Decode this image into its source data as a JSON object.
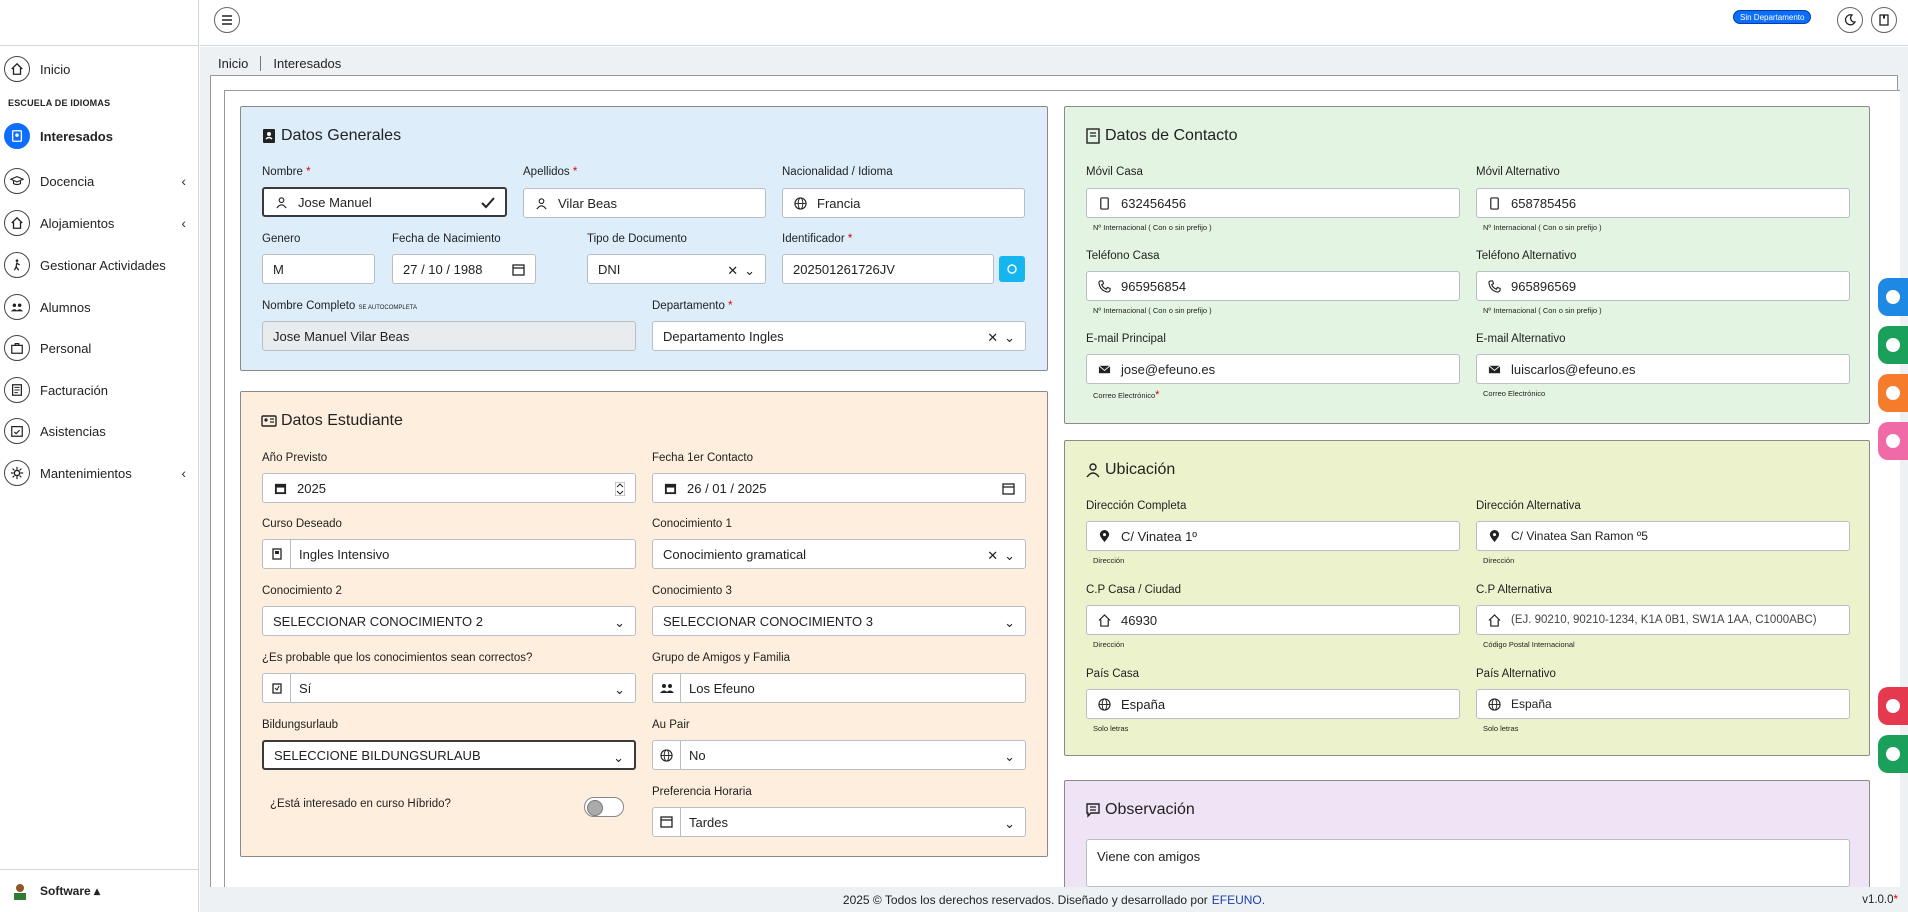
{
  "sidebar": {
    "home": "Inicio",
    "section": "ESCUELA DE IDIOMAS",
    "items": [
      {
        "label": "Interesados",
        "icon": "user-badge-icon",
        "chevron": ""
      },
      {
        "label": "Docencia",
        "icon": "graduation-cap-icon",
        "chevron": "‹"
      },
      {
        "label": "Alojamientos",
        "icon": "house-icon",
        "chevron": "‹"
      },
      {
        "label": "Gestionar Actividades",
        "icon": "hiking-icon",
        "chevron": ""
      },
      {
        "label": "Alumnos",
        "icon": "users-icon",
        "chevron": ""
      },
      {
        "label": "Personal",
        "icon": "briefcase-icon",
        "chevron": ""
      },
      {
        "label": "Facturación",
        "icon": "invoice-icon",
        "chevron": ""
      },
      {
        "label": "Asistencias",
        "icon": "calendar-check-icon",
        "chevron": ""
      },
      {
        "label": "Mantenimientos",
        "icon": "gear-icon",
        "chevron": "‹"
      }
    ],
    "bottom": "Software ▴"
  },
  "topbar": {
    "badge": "Sin Departamento"
  },
  "breadcrumb": {
    "home": "Inicio",
    "current": "Interesados"
  },
  "generales": {
    "title": "Datos Generales",
    "nombre_label": "Nombre",
    "nombre": "Jose Manuel",
    "apellidos_label": "Apellidos",
    "apellidos": "Vilar Beas",
    "nacionalidad_label": "Nacionalidad / Idioma",
    "nacionalidad": "Francia",
    "genero_label": "Genero",
    "genero": "M",
    "fecha_label": "Fecha de Nacimiento",
    "fecha": "27 / 10 / 1988",
    "tipo_doc_label": "Tipo de Documento",
    "tipo_doc": "DNI",
    "identificador_label": "Identificador",
    "identificador": "202501261726JV",
    "completo_label": "Nombre Completo",
    "completo_hint": "se autocompleta",
    "completo": "Jose Manuel Vilar Beas",
    "departamento_label": "Departamento",
    "departamento": "Departamento Ingles",
    "required_mark": "*"
  },
  "estudiante": {
    "title": "Datos Estudiante",
    "anio_label": "Año Previsto",
    "anio": "2025",
    "contacto_label": "Fecha 1er Contacto",
    "contacto": "26 / 01 / 2025",
    "curso_label": "Curso Deseado",
    "curso": "Ingles Intensivo",
    "con1_label": "Conocimiento 1",
    "con1": "Conocimiento gramatical",
    "con2_label": "Conocimiento 2",
    "con2": "SELECCIONAR CONOCIMIENTO 2",
    "con3_label": "Conocimiento 3",
    "con3": "SELECCIONAR CONOCIMIENTO 3",
    "probable_label": "¿Es probable que los conocimientos sean correctos?",
    "probable": "Sí",
    "grupo_label": "Grupo de Amigos y Familia",
    "grupo": "Los Efeuno",
    "bildung_label": "Bildungsurlaub",
    "bildung": "SELECCIONE BILDUNGSURLAUB",
    "aupair_label": "Au Pair",
    "aupair": "No",
    "hibrido_label": "¿Está interesado en curso Híbrido?",
    "preferencia_label": "Preferencia Horaria",
    "preferencia": "Tardes"
  },
  "contacto": {
    "title": "Datos de Contacto",
    "movil_label": "Móvil Casa",
    "movil": "632456456",
    "movil_alt_label": "Móvil Alternativo",
    "movil_alt": "658785456",
    "intl_hint": "Nº Internacional ( Con o sin prefijo )",
    "tel_label": "Teléfono Casa",
    "tel": "965956854",
    "tel_alt_label": "Teléfono Alternativo",
    "tel_alt": "965896569",
    "email_label": "E-mail Principal",
    "email": "jose@efeuno.es",
    "email_alt_label": "E-mail Alternativo",
    "email_alt": "luiscarlos@efeuno.es",
    "email_hint": "Correo Electrónico",
    "required_mark": "*"
  },
  "ubicacion": {
    "title": "Ubicación",
    "dir_label": "Dirección Completa",
    "dir": "C/ Vinatea 1º",
    "dir_alt_label": "Dirección Alternativa",
    "dir_alt": "C/ Vinatea San Ramon º5",
    "dir_hint": "Dirección",
    "cp_label": "C.P Casa / Ciudad",
    "cp": "46930",
    "cp_alt_label": "C.P Alternativa",
    "cp_alt_placeholder": "(EJ. 90210, 90210-1234, K1A 0B1, SW1A 1AA, C1000ABC)",
    "cp_hint": "Dirección",
    "cp_alt_hint": "Código Postal Internacional",
    "pais_label": "País Casa",
    "pais": "España",
    "pais_alt_label": "País Alternativo",
    "pais_alt": "España",
    "pais_hint": "Solo letras"
  },
  "observacion": {
    "title": "Observación",
    "text": "Viene con amigos"
  },
  "footer": {
    "text": "2025 © Todos los derechos reservados. Diseñado y desarrollado por",
    "link": "EFEUNO.",
    "version": "v1.0.0",
    "version_mark": "*"
  },
  "colors": {
    "accent": "#0d6efd",
    "blue_panel": "#ddeefa",
    "peach_panel": "#fdeedd",
    "green_panel": "#e4f4e2",
    "yellow_panel": "#ecf3cc",
    "lilac_panel": "#efe4f5"
  }
}
